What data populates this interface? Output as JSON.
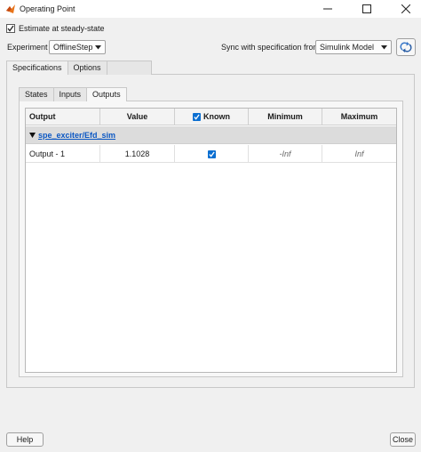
{
  "window": {
    "title": "Operating Point",
    "icon": "matlab-logo-icon",
    "controls": [
      "minimize-icon",
      "maximize-icon",
      "close-icon"
    ]
  },
  "estimate": {
    "label": "Estimate at steady-state",
    "checked": true
  },
  "experiment": {
    "label": "Experiment",
    "value": "OfflineStep"
  },
  "sync": {
    "label": "Sync with specification from",
    "value": "Simulink Model",
    "button_icon": "sync-icon"
  },
  "outer_tabs": [
    {
      "label": "Specifications",
      "active": true
    },
    {
      "label": "Options",
      "active": false
    }
  ],
  "inner_tabs": [
    {
      "label": "States",
      "active": false
    },
    {
      "label": "Inputs",
      "active": false
    },
    {
      "label": "Outputs",
      "active": true
    }
  ],
  "table": {
    "columns": [
      "Output",
      "Value",
      "Known",
      "Minimum",
      "Maximum"
    ],
    "known_header_checked": true,
    "group": "spe_exciter/Efd_sim",
    "rows": [
      {
        "output": "Output - 1",
        "value": "1.1028",
        "known": true,
        "minimum": "-Inf",
        "maximum": "Inf"
      }
    ]
  },
  "buttons": {
    "help": "Help",
    "close": "Close"
  },
  "colors": {
    "accent": "#0b6fd1",
    "link": "#0b57c3"
  }
}
